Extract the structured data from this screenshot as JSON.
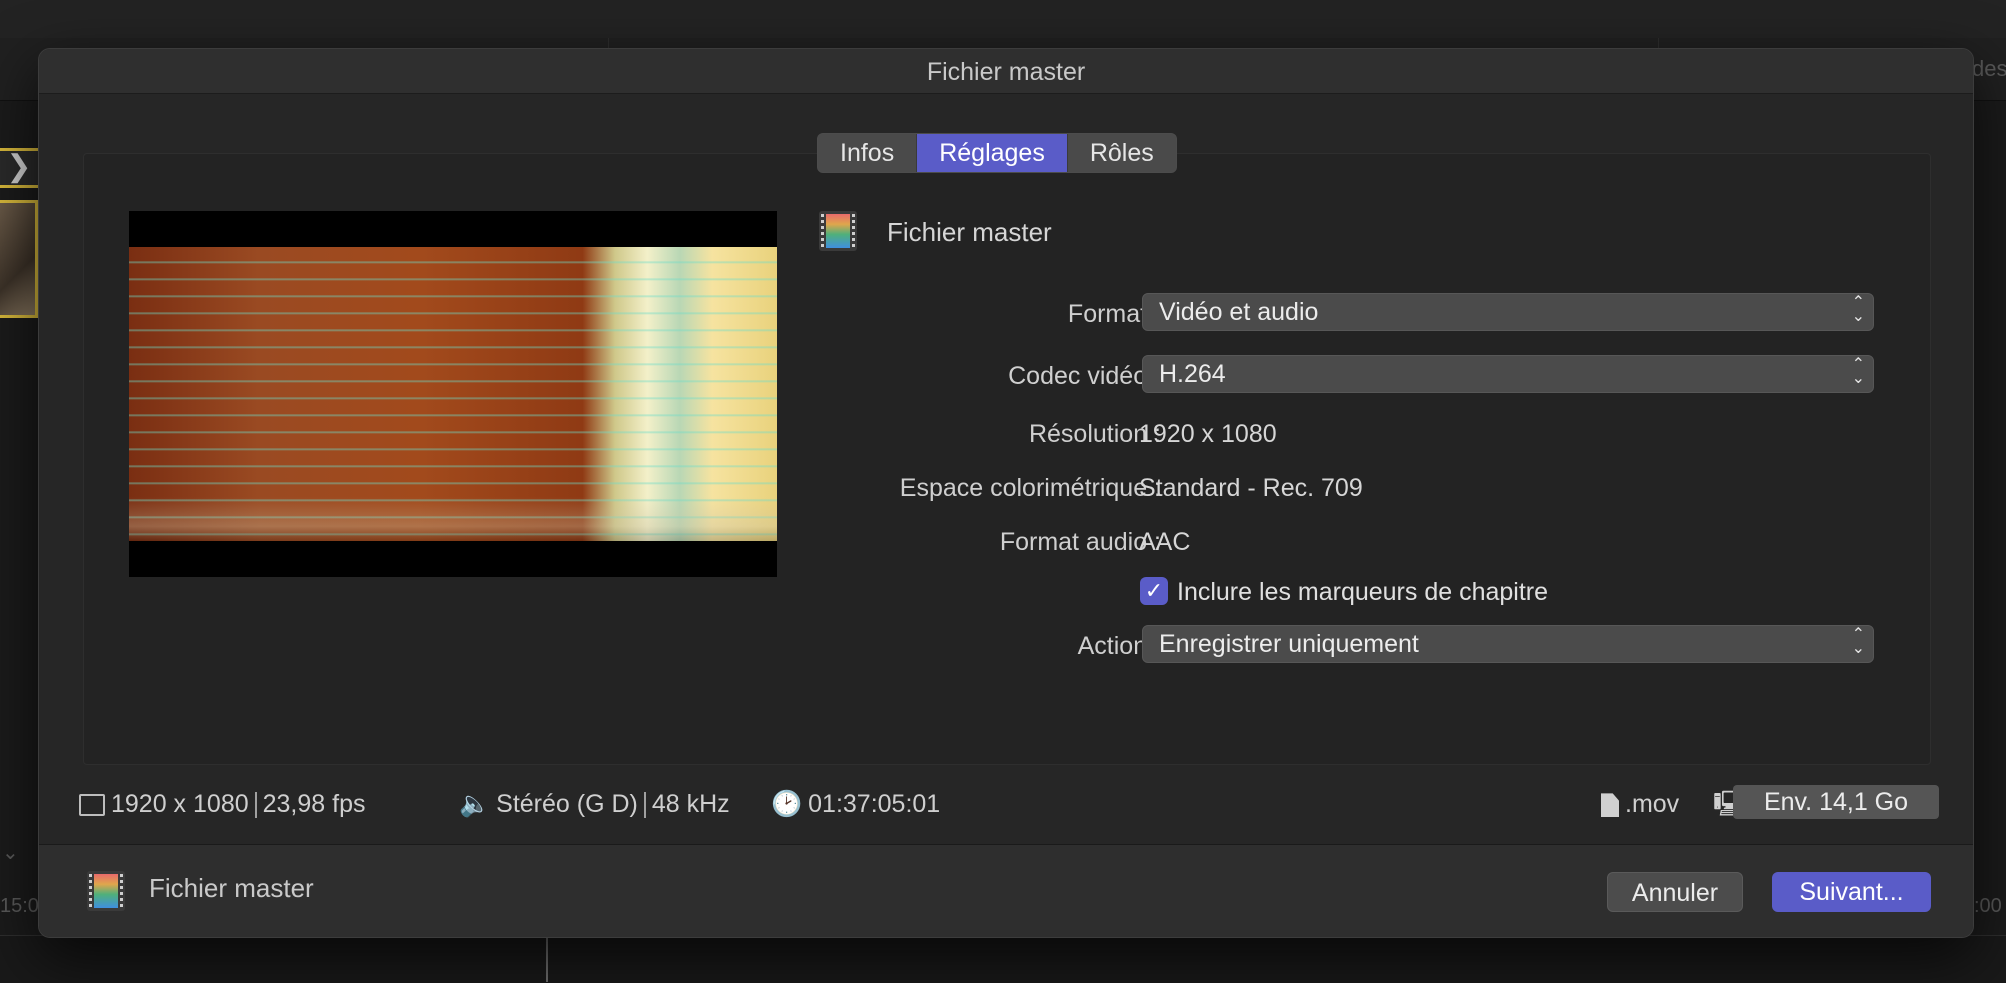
{
  "background": {
    "edge_text": "des",
    "timeline_left": "15:0",
    "timeline_right": ":00"
  },
  "dialog": {
    "title": "Fichier master",
    "tabs": [
      {
        "label": "Infos"
      },
      {
        "label": "Réglages"
      },
      {
        "label": "Rôles"
      }
    ],
    "active_tab": "Réglages",
    "destination_name": "Fichier master",
    "fields": {
      "format_label": "Format :",
      "format_value": "Vidéo et audio",
      "codec_label": "Codec vidéo :",
      "codec_value": "H.264",
      "resolution_label": "Résolution :",
      "resolution_value": "1920 x 1080",
      "colorspace_label": "Espace colorimétrique :",
      "colorspace_value": "Standard - Rec. 709",
      "audio_format_label": "Format audio :",
      "audio_format_value": "AAC",
      "chapters_checkbox_label": "Inclure les marqueurs de chapitre",
      "chapters_checked": true,
      "action_label": "Action :",
      "action_value": "Enregistrer uniquement"
    },
    "status": {
      "resolution": "1920 x 1080",
      "fps": "23,98 fps",
      "audio_channels": "Stéréo (G D)",
      "sample_rate": "48 kHz",
      "duration": "01:37:05:01",
      "extension": ".mov",
      "size": "Env. 14,1 Go"
    },
    "footer": {
      "destination_name": "Fichier master",
      "cancel_label": "Annuler",
      "next_label": "Suivant..."
    }
  },
  "colors": {
    "accent": "#5a5cc8",
    "dialog_bg": "#262626"
  }
}
